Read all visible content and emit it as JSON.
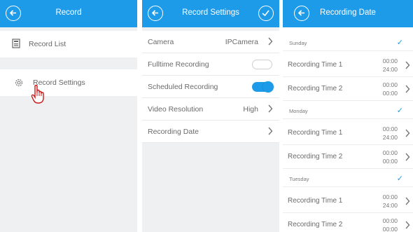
{
  "panel1": {
    "title": "Record",
    "items": [
      {
        "label": "Record List",
        "icon": "file-icon"
      },
      {
        "label": "Record Settings",
        "icon": "gear-icon"
      }
    ]
  },
  "panel2": {
    "title": "Record Settings",
    "rows": [
      {
        "label": "Camera",
        "value": "IPCamera"
      },
      {
        "label": "Fulltime Recording",
        "toggle": false
      },
      {
        "label": "Scheduled Recording",
        "toggle": true
      },
      {
        "label": "Video Resolution",
        "value": "High"
      },
      {
        "label": "Recording Date",
        "value": ""
      }
    ]
  },
  "panel3": {
    "title": "Recording Date",
    "days": [
      {
        "name": "Sunday",
        "checked": true,
        "times": [
          {
            "label": "Recording Time 1",
            "start": "00:00",
            "end": "24:00"
          },
          {
            "label": "Recording Time 2",
            "start": "00:00",
            "end": "00:00"
          }
        ]
      },
      {
        "name": "Monday",
        "checked": true,
        "times": [
          {
            "label": "Recording Time 1",
            "start": "00:00",
            "end": "24:00"
          },
          {
            "label": "Recording Time 2",
            "start": "00:00",
            "end": "00:00"
          }
        ]
      },
      {
        "name": "Tuesday",
        "checked": true,
        "times": [
          {
            "label": "Recording Time 1",
            "start": "00:00",
            "end": "24:00"
          },
          {
            "label": "Recording Time 2",
            "start": "00:00",
            "end": "00:00"
          }
        ]
      }
    ]
  },
  "colors": {
    "accent": "#1e9be8",
    "cursor": "#cc1a1a"
  }
}
